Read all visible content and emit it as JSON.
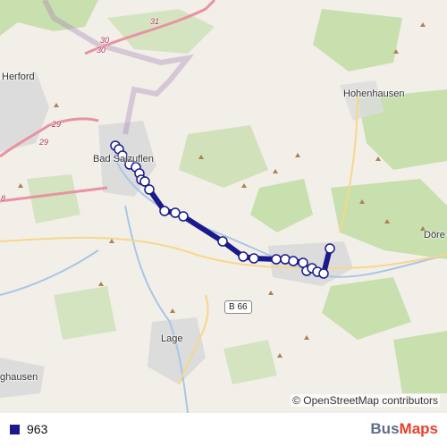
{
  "map": {
    "places": [
      "Herford",
      "Hohenhausen",
      "Bad Salzuflen",
      "Lage",
      "Döre",
      "ghausen"
    ],
    "road_labels": [
      "31",
      "30",
      "30",
      "29",
      "29",
      "8"
    ],
    "shield": "B 66",
    "attribution": "© OpenStreetMap contributors",
    "colors": {
      "route": "#1a1a8c",
      "land": "#f2efe9",
      "forest": "#c8dfae",
      "urban": "#dcdcdc",
      "water": "#a9c6e5",
      "motorway": "#e892a2",
      "border": "#a27fb7"
    }
  },
  "legend": {
    "route_number": "963",
    "route_color": "#1a1a8c"
  },
  "brand": {
    "part1": "Bus",
    "part2": "Maps"
  }
}
